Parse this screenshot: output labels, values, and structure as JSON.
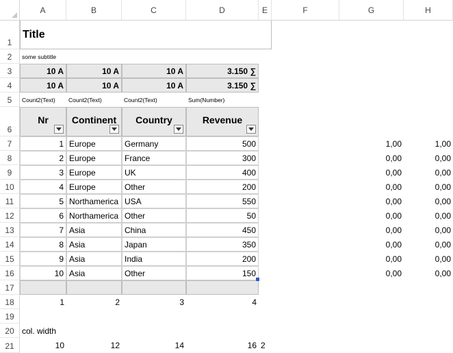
{
  "columns": [
    "A",
    "B",
    "C",
    "D",
    "E",
    "F",
    "G",
    "H"
  ],
  "rows": [
    "1",
    "2",
    "3",
    "4",
    "5",
    "6",
    "7",
    "8",
    "9",
    "10",
    "11",
    "12",
    "13",
    "14",
    "15",
    "16",
    "17",
    "18",
    "19",
    "20",
    "21"
  ],
  "title": "Title",
  "subtitle": "some subtitle",
  "summary_rows": [
    [
      "10 A",
      "10 A",
      "10 A",
      "3.150 ∑"
    ],
    [
      "10 A",
      "10 A",
      "10 A",
      "3.150 ∑"
    ]
  ],
  "aggregate_labels": [
    "Count2(Text)",
    "Count2(Text)",
    "Count2(Text)",
    "Sum(Number)"
  ],
  "headers": [
    "Nr",
    "Continent",
    "Country",
    "Revenue"
  ],
  "table": [
    [
      "1",
      "Europe",
      "Germany",
      "500",
      "1,00",
      "1,00"
    ],
    [
      "2",
      "Europe",
      "France",
      "300",
      "0,00",
      "0,00"
    ],
    [
      "3",
      "Europe",
      "UK",
      "400",
      "0,00",
      "0,00"
    ],
    [
      "4",
      "Europe",
      "Other",
      "200",
      "0,00",
      "0,00"
    ],
    [
      "5",
      "Northamerica",
      "USA",
      "550",
      "0,00",
      "0,00"
    ],
    [
      "6",
      "Northamerica",
      "Other",
      "50",
      "0,00",
      "0,00"
    ],
    [
      "7",
      "Asia",
      "China",
      "450",
      "0,00",
      "0,00"
    ],
    [
      "8",
      "Asia",
      "Japan",
      "350",
      "0,00",
      "0,00"
    ],
    [
      "9",
      "Asia",
      "India",
      "200",
      "0,00",
      "0,00"
    ],
    [
      "10",
      "Asia",
      "Other",
      "150",
      "0,00",
      "0,00"
    ]
  ],
  "col_index_row": [
    "1",
    "2",
    "3",
    "4"
  ],
  "col_width_label": "col. width",
  "col_widths": [
    "10",
    "12",
    "14",
    "16",
    "2"
  ],
  "colors": {
    "header_fill": "#e8e8e8",
    "selection_handle": "#2e55c5"
  }
}
